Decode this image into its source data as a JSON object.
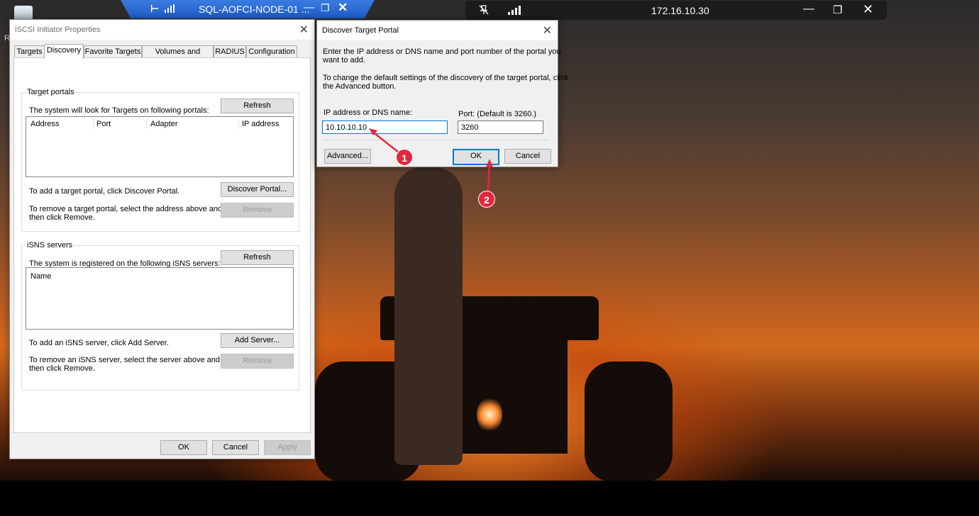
{
  "rdp_bar": {
    "title": "SQL-AOFCI-NODE-01 ...",
    "pin_glyph": "⊢",
    "minimize_glyph": "—",
    "restore_glyph": "❐",
    "close_glyph": "✕"
  },
  "remote_bar": {
    "host": "172.16.10.30",
    "minimize_glyph": "—",
    "restore_glyph": "❐",
    "close_glyph": "✕"
  },
  "desktop": {
    "icon_letter": "R"
  },
  "iscsi_window": {
    "title": "iSCSI Initiator Properties",
    "close_glyph": "✕",
    "tabs": [
      "Targets",
      "Discovery",
      "Favorite Targets",
      "Volumes and Devices",
      "RADIUS",
      "Configuration"
    ],
    "active_tab": "Discovery",
    "target_portals": {
      "group_label": "Target portals",
      "description": "The system will look for Targets on following portals:",
      "refresh_label": "Refresh",
      "columns": [
        "Address",
        "Port",
        "Adapter",
        "IP address"
      ],
      "add_text": "To add a target portal, click Discover Portal.",
      "discover_label": "Discover Portal...",
      "remove_text_1": "To remove a target portal, select the address above and",
      "remove_text_2": "then click Remove.",
      "remove_label": "Remove"
    },
    "isns_servers": {
      "group_label": "iSNS servers",
      "description": "The system is registered on the following iSNS servers:",
      "refresh_label": "Refresh",
      "columns": [
        "Name"
      ],
      "add_text": "To add an iSNS server, click Add Server.",
      "add_label": "Add Server...",
      "remove_text_1": "To remove an iSNS server, select the server above and",
      "remove_text_2": "then click Remove.",
      "remove_label": "Remove"
    },
    "footer": {
      "ok_label": "OK",
      "cancel_label": "Cancel",
      "apply_label": "Apply"
    }
  },
  "discover_dialog": {
    "title": "Discover Target Portal",
    "close_glyph": "✕",
    "intro_1": "Enter the IP address or DNS name and port number of the portal you",
    "intro_2": "want to add.",
    "advanced_text_1": "To change the default settings of the discovery of the target portal, click",
    "advanced_text_2": "the Advanced button.",
    "ip_label": "IP address or DNS name:",
    "ip_value": "10.10.10.10",
    "port_label": "Port: (Default is 3260.)",
    "port_value": "3260",
    "advanced_label": "Advanced...",
    "ok_label": "OK",
    "cancel_label": "Cancel"
  },
  "annotations": {
    "step1": "1",
    "step2": "2",
    "color": "#e3283e"
  }
}
